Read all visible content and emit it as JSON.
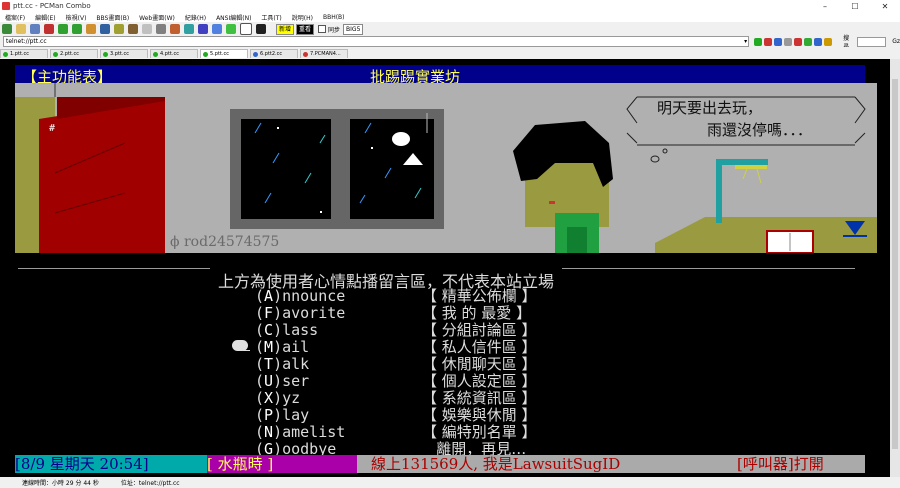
{
  "window": {
    "title": "ptt.cc - PCMan Combo",
    "controls": [
      "–",
      "☐",
      "✕"
    ]
  },
  "menu": [
    "檔案(F)",
    "編輯(E)",
    "檢視(V)",
    "BBS畫面(B)",
    "Web畫面(W)",
    "紀錄(H)",
    "ANSI編輯(N)",
    "工具(T)",
    "說明(H)",
    "BBH(B)"
  ],
  "toolbar": {
    "new_label": "新增",
    "buttons": [
      "重看"
    ],
    "checkbox_label": "同步",
    "encoding": "BIG5"
  },
  "address": {
    "value": "telnet://ptt.cc"
  },
  "search": {
    "label": "搜尋",
    "extra": "Gz"
  },
  "tabs": [
    "1.ptt.cc",
    "2.ptt.cc",
    "3.ptt.cc",
    "4.ptt.cc",
    "5.ptt.cc",
    "6.ptt2.cc",
    "7.PCMAN4..."
  ],
  "active_tab": 4,
  "terminal": {
    "header_left": "【主功能表】",
    "header_center": "批踢踢實業坊",
    "speech_line1": "明天要出去玩，",
    "speech_line2": "雨還沒停嗎．．．",
    "signature": "ϕ rod24574575",
    "divider_text": "上方為使用者心情點播留言區，不代表本站立場",
    "menu": [
      {
        "key": "A",
        "rest": "nnounce",
        "desc": "【 精華公佈欄 】"
      },
      {
        "key": "F",
        "rest": "avorite",
        "desc": "【 我 的 最愛 】"
      },
      {
        "key": "C",
        "rest": "lass",
        "desc": "【 分組討論區 】"
      },
      {
        "key": "M",
        "rest": "ail",
        "desc": "【 私人信件區 】"
      },
      {
        "key": "T",
        "rest": "alk",
        "desc": "【 休閒聊天區 】"
      },
      {
        "key": "U",
        "rest": "ser",
        "desc": "【 個人設定區 】"
      },
      {
        "key": "X",
        "rest": "yz",
        "desc": "【 系統資訊區 】"
      },
      {
        "key": "P",
        "rest": "lay",
        "desc": "【 娛樂與休閒 】"
      },
      {
        "key": "N",
        "rest": "amelist",
        "desc": "【 編特別名單 】"
      },
      {
        "key": "G",
        "rest": "oodbye",
        "desc": "   離開，再見…"
      }
    ],
    "status_date": "[8/9 星期天 20:54]",
    "status_zodiac": "[ 水瓶時 ]",
    "status_online": "線上131569人, 我是LawsuitSugID",
    "status_pager": "[呼叫器]打開"
  },
  "statusbar": {
    "text1": "連線時間：小時 29 分 44 秒",
    "text2": "位址：telnet://ptt.cc"
  },
  "colors": {
    "terminal_bg": "#000000",
    "header_bg": "#00008a",
    "yellow": "#ffff55",
    "status_cyan": "#00aaaa",
    "status_magenta": "#aa00aa"
  }
}
